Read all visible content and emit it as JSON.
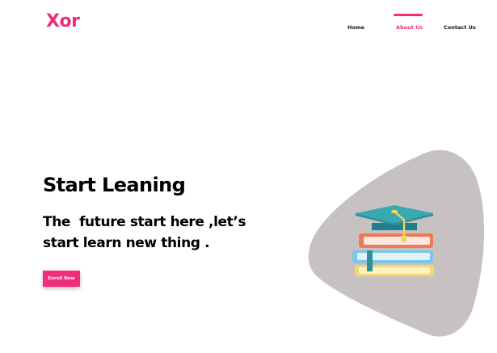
{
  "brand": {
    "logo_text": "Xor",
    "accent": "#f02d7d"
  },
  "nav": {
    "items": [
      {
        "label": "Home",
        "active": false
      },
      {
        "label": "About Us",
        "active": true
      },
      {
        "label": "Contact Us",
        "active": false
      }
    ],
    "text_color": "#111111"
  },
  "hero": {
    "title": "Start Leaning",
    "subtitle": "The  future start here ,let’s\nstart learn new thing .",
    "cta_label": "Enroll Now"
  },
  "illustration": {
    "icon": "graduation-books-icon",
    "blob_color": "#c8c1c2"
  }
}
